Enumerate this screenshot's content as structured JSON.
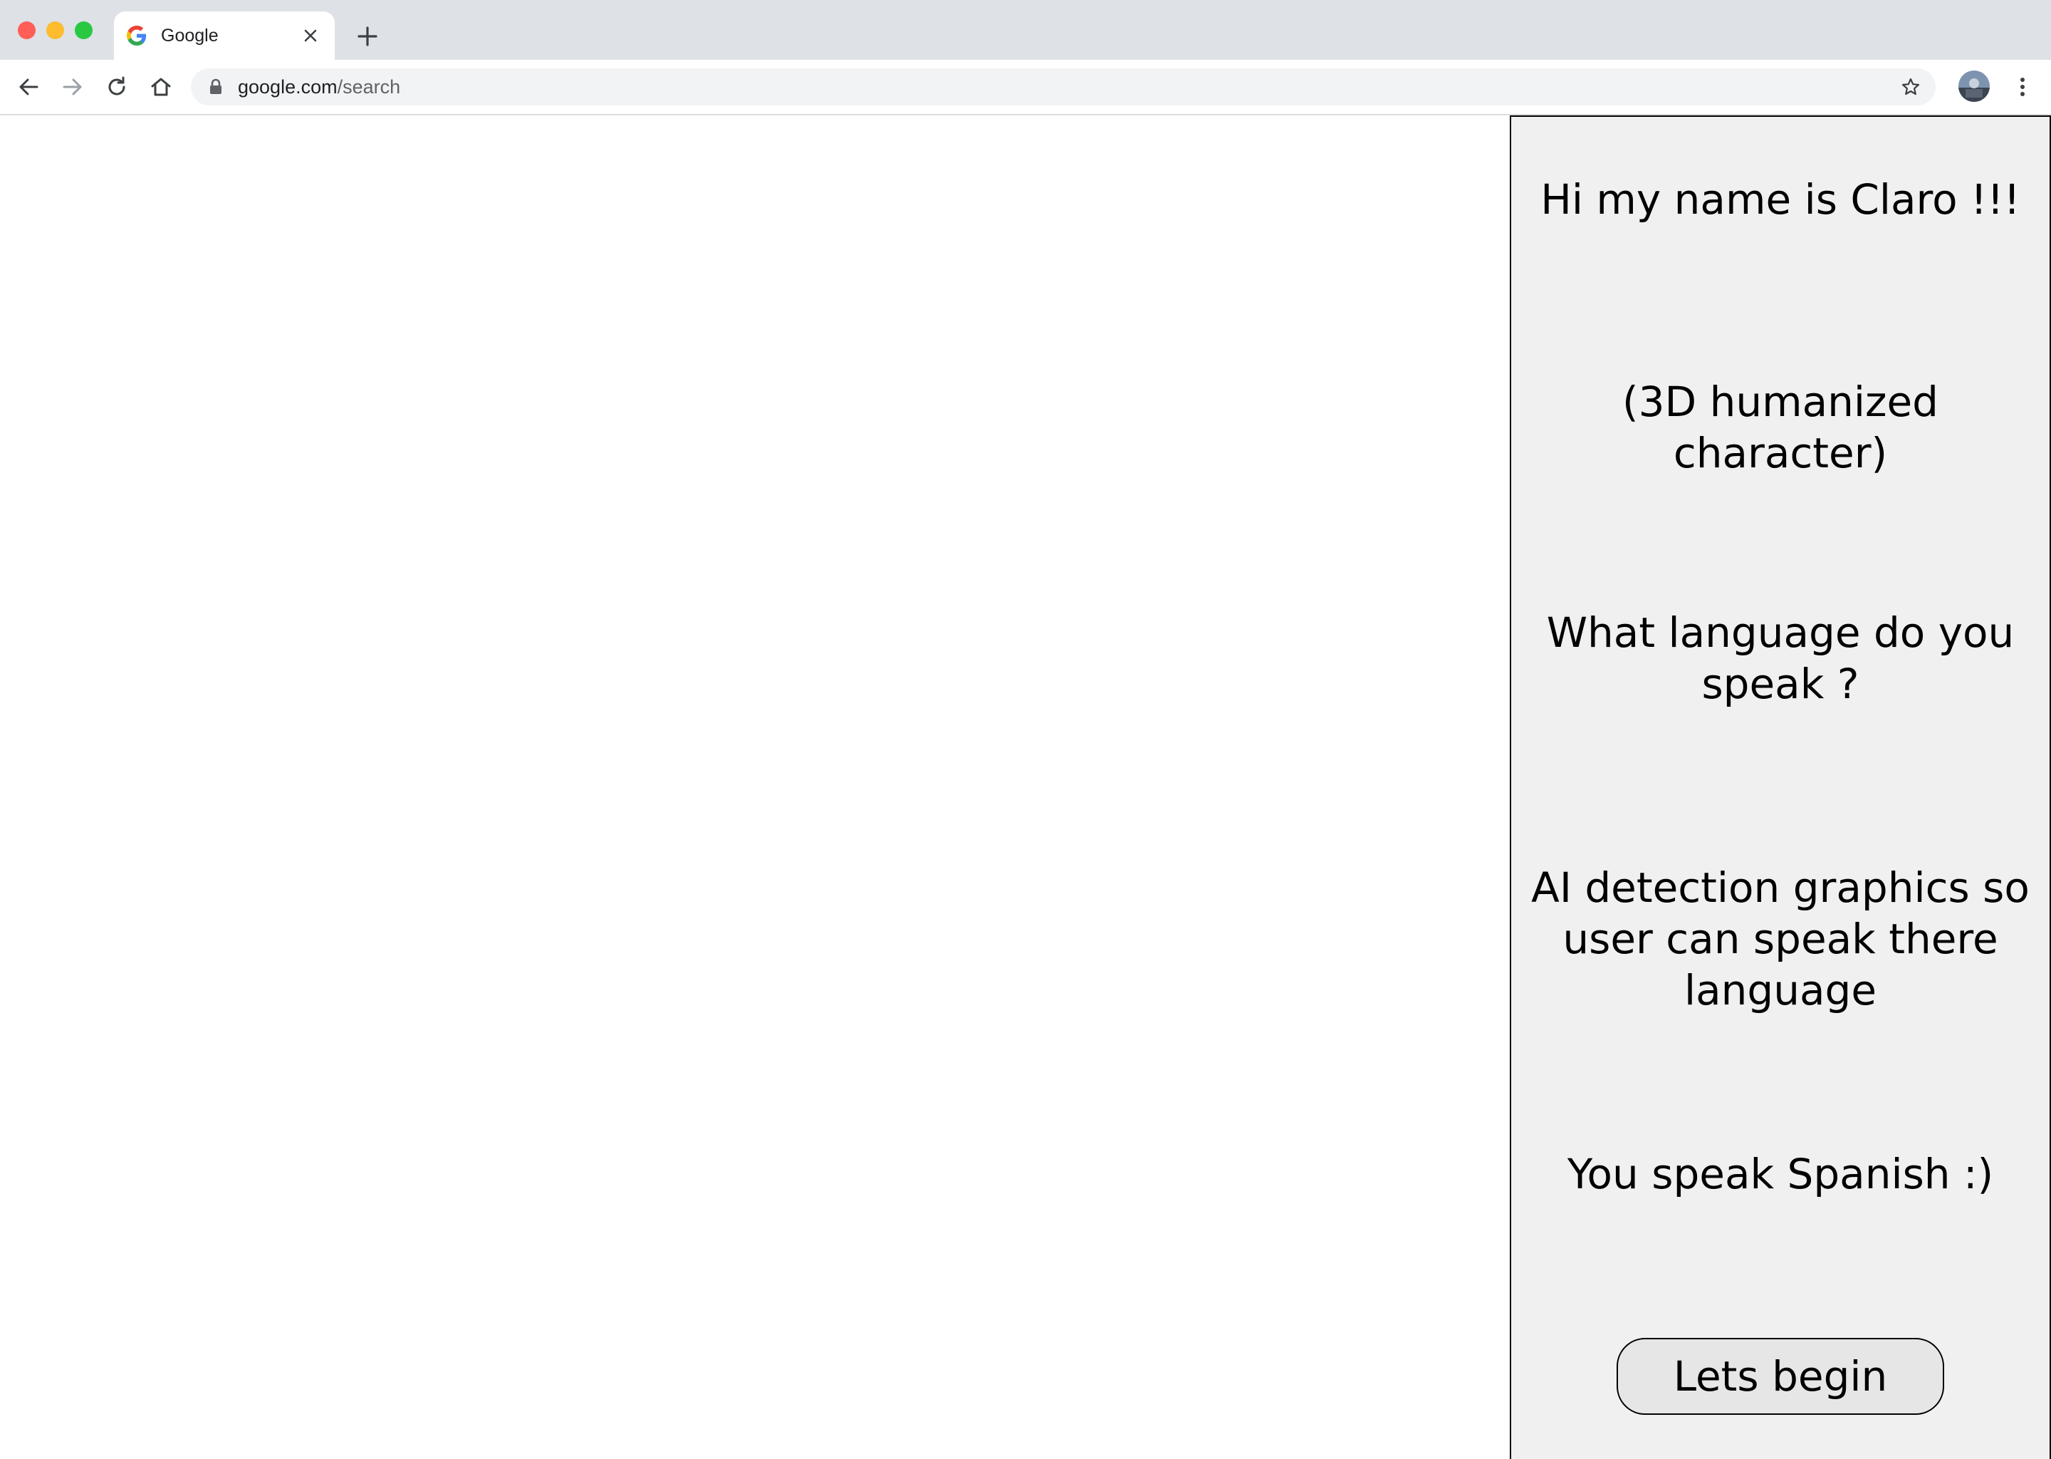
{
  "browser": {
    "tab": {
      "title": "Google",
      "favicon": "google-g-icon"
    },
    "toolbar": {
      "url_host": "google.com",
      "url_path": "/search"
    },
    "icons": {
      "back": "arrow-left-icon",
      "forward": "arrow-right-icon",
      "reload": "reload-icon",
      "home": "home-icon",
      "lock": "lock-icon",
      "bookmark": "star-icon",
      "menu": "more-vert-icon",
      "close_tab": "close-icon",
      "new_tab": "plus-icon"
    },
    "colors": {
      "tabstrip": "#dee1e6",
      "traffic_red": "#ff5f57",
      "traffic_yellow": "#febc2e",
      "traffic_green": "#28c840"
    }
  },
  "panel": {
    "greeting": "Hi my name is Claro !!!",
    "character_note": "(3D humanized character)",
    "question": "What language do you speak ?",
    "ai_note": "AI detection graphics so user can speak there language",
    "result": "You speak Spanish :)",
    "begin_button": "Lets begin",
    "background": "#eff0ef"
  }
}
